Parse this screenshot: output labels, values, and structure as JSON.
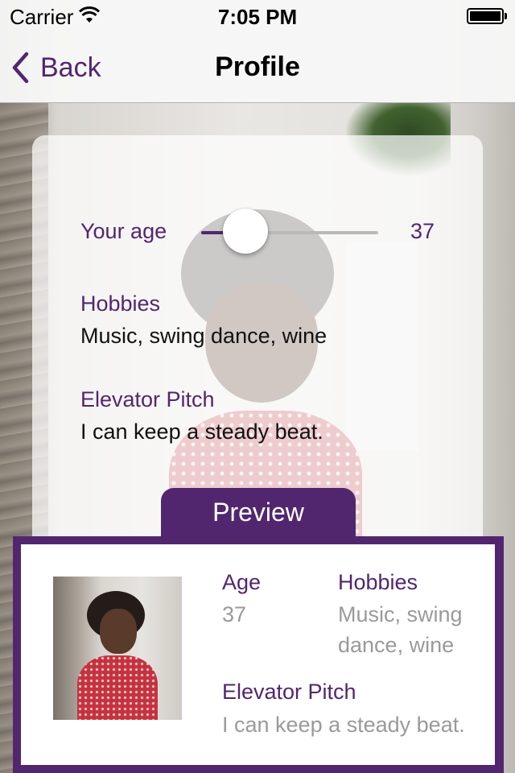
{
  "status_bar": {
    "carrier": "Carrier",
    "time": "7:05 PM"
  },
  "nav": {
    "back_label": "Back",
    "title": "Profile"
  },
  "form": {
    "age": {
      "label": "Your age",
      "value": "37",
      "slider_fraction": 0.25
    },
    "hobbies": {
      "label": "Hobbies",
      "value": "Music, swing dance, wine"
    },
    "pitch": {
      "label": "Elevator Pitch",
      "value": "I can keep a steady beat."
    }
  },
  "preview": {
    "tab_label": "Preview",
    "age": {
      "label": "Age",
      "value": "37"
    },
    "hobbies": {
      "label": "Hobbies",
      "value_line1": "Music, swing",
      "value_line2": "dance, wine"
    },
    "pitch": {
      "label": "Elevator Pitch",
      "value": "I can keep a steady beat."
    }
  },
  "colors": {
    "accent": "#52266f",
    "muted": "#9a9a9a"
  },
  "icons": {
    "back": "chevron-left-icon",
    "wifi": "wifi-icon",
    "battery": "battery-icon"
  }
}
